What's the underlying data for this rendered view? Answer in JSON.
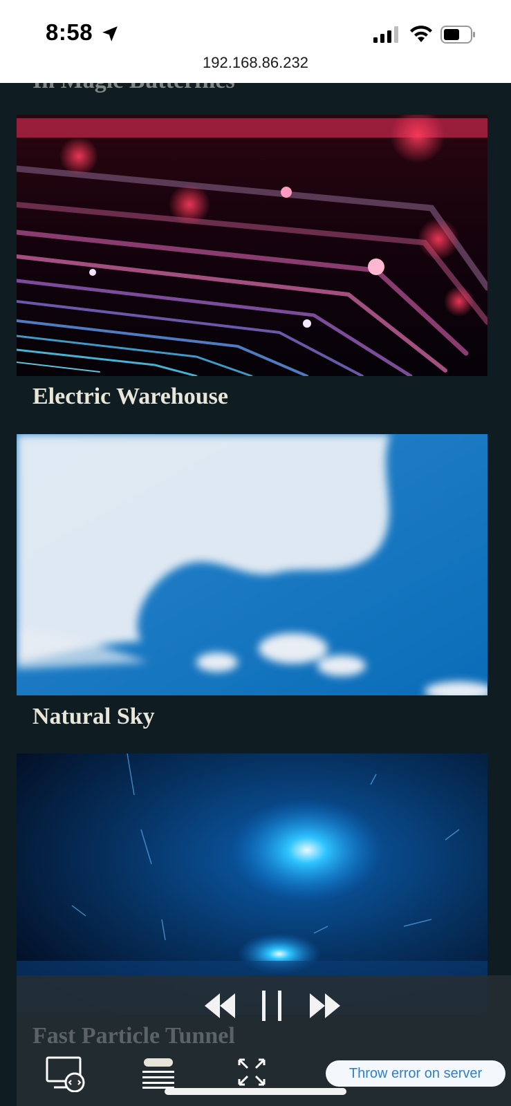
{
  "status_bar": {
    "time": "8:58",
    "url": "192.168.86.232",
    "icons": [
      "location-arrow-icon",
      "cellular-signal-icon",
      "wifi-icon",
      "battery-icon"
    ]
  },
  "videos": {
    "partial_title": "In Magic Butterflies",
    "items": [
      {
        "title": "Electric Warehouse"
      },
      {
        "title": "Natural Sky"
      },
      {
        "title": "Fast Particle Tunnel"
      }
    ]
  },
  "player": {
    "icons": [
      "rewind-icon",
      "pause-icon",
      "fast-forward-icon",
      "cast-screen-icon",
      "playlist-icon",
      "fullscreen-icon"
    ],
    "error_button_label": "Throw error on server"
  },
  "colors": {
    "background": "#0f1c22",
    "title_text": "#e8e6d8",
    "accent_link": "#2e7fd0"
  }
}
